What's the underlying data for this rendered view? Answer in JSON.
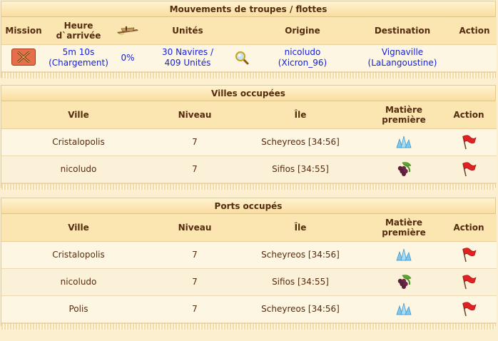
{
  "movements": {
    "title": "Mouvements de troupes / flottes",
    "headers": {
      "mission": "Mission",
      "arrival": "Heure d`arrivée",
      "units": "Unités",
      "origin": "Origine",
      "destination": "Destination",
      "action": "Action"
    },
    "rows": [
      {
        "time": "5m 10s",
        "status": "(Chargement)",
        "progress": "0%",
        "units_line1": "30 Navires /",
        "units_line2": "409 Unités",
        "origin_city": "nicoludo",
        "origin_player": "(Xicron_96)",
        "dest_city": "Vignaville",
        "dest_player": "(LaLangoustine)"
      }
    ]
  },
  "occupied_cities": {
    "title": "Villes occupées",
    "headers": {
      "city": "Ville",
      "level": "Niveau",
      "island": "Île",
      "resource": "Matière première",
      "action": "Action"
    },
    "rows": [
      {
        "city": "Cristalopolis",
        "level": "7",
        "island": "Scheyreos [34:56]",
        "resource": "crystal-icon"
      },
      {
        "city": "nicoludo",
        "level": "7",
        "island": "Sifios [34:55]",
        "resource": "wine-icon"
      }
    ]
  },
  "occupied_ports": {
    "title": "Ports occupés",
    "headers": {
      "city": "Ville",
      "level": "Niveau",
      "island": "Île",
      "resource": "Matière première",
      "action": "Action"
    },
    "rows": [
      {
        "city": "Cristalopolis",
        "level": "7",
        "island": "Scheyreos [34:56]",
        "resource": "crystal-icon"
      },
      {
        "city": "nicoludo",
        "level": "7",
        "island": "Sifios [34:55]",
        "resource": "wine-icon"
      },
      {
        "city": "Polis",
        "level": "7",
        "island": "Scheyreos [34:56]",
        "resource": "crystal-icon"
      }
    ]
  },
  "colors": {
    "link": "#1520d8",
    "text": "#542c0f",
    "header_bg": "#fbe5b0",
    "background": "#fbefcf"
  }
}
